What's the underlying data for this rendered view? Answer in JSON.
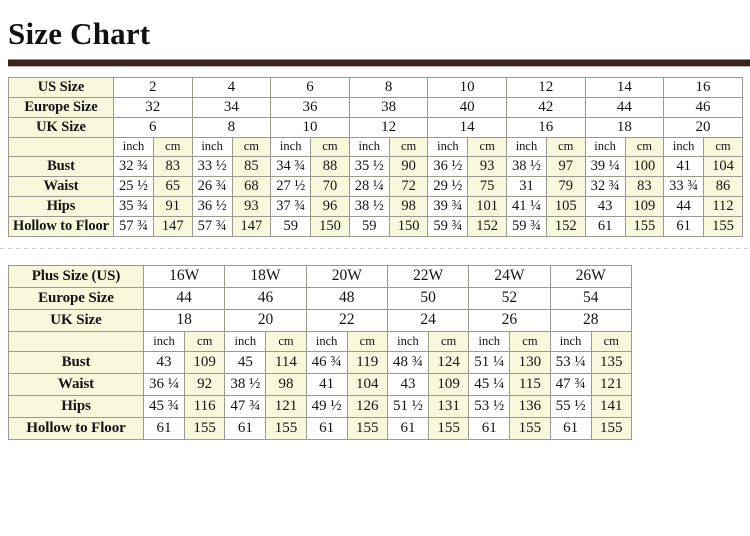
{
  "page": {
    "title": "Size Chart"
  },
  "standard_table": {
    "row_labels": {
      "us": "US Size",
      "europe": "Europe Size",
      "uk": "UK Size",
      "bust": "Bust",
      "waist": "Waist",
      "hips": "Hips",
      "hollow": "Hollow to Floor"
    },
    "units": {
      "inch": "inch",
      "cm": "cm"
    },
    "us_sizes": [
      "2",
      "4",
      "6",
      "8",
      "10",
      "12",
      "14",
      "16"
    ],
    "europe_sizes": [
      "32",
      "34",
      "36",
      "38",
      "40",
      "42",
      "44",
      "46"
    ],
    "uk_sizes": [
      "6",
      "8",
      "10",
      "12",
      "14",
      "16",
      "18",
      "20"
    ],
    "bust_inch": [
      "32 ¾",
      "33 ½",
      "34 ¾",
      "35 ½",
      "36 ½",
      "38 ½",
      "39 ¼",
      "41"
    ],
    "bust_cm": [
      "83",
      "85",
      "88",
      "90",
      "93",
      "97",
      "100",
      "104"
    ],
    "waist_inch": [
      "25 ½",
      "26 ¾",
      "27 ½",
      "28 ¼",
      "29 ½",
      "31",
      "32 ¾",
      "33 ¾"
    ],
    "waist_cm": [
      "65",
      "68",
      "70",
      "72",
      "75",
      "79",
      "83",
      "86"
    ],
    "hips_inch": [
      "35 ¾",
      "36 ½",
      "37 ¾",
      "38 ½",
      "39 ¾",
      "41 ¼",
      "43",
      "44"
    ],
    "hips_cm": [
      "91",
      "93",
      "96",
      "98",
      "101",
      "105",
      "109",
      "112"
    ],
    "hollow_inch": [
      "57 ¾",
      "57 ¾",
      "59",
      "59",
      "59 ¾",
      "59 ¾",
      "61",
      "61"
    ],
    "hollow_cm": [
      "147",
      "147",
      "150",
      "150",
      "152",
      "152",
      "155",
      "155"
    ]
  },
  "plus_table": {
    "row_labels": {
      "plus": "Plus Size (US)",
      "europe": "Europe Size",
      "uk": "UK Size",
      "bust": "Bust",
      "waist": "Waist",
      "hips": "Hips",
      "hollow": "Hollow to Floor"
    },
    "units": {
      "inch": "inch",
      "cm": "cm"
    },
    "plus_sizes": [
      "16W",
      "18W",
      "20W",
      "22W",
      "24W",
      "26W"
    ],
    "europe_sizes": [
      "44",
      "46",
      "48",
      "50",
      "52",
      "54"
    ],
    "uk_sizes": [
      "18",
      "20",
      "22",
      "24",
      "26",
      "28"
    ],
    "bust_inch": [
      "43",
      "45",
      "46 ¾",
      "48 ¾",
      "51 ¼",
      "53 ¼"
    ],
    "bust_cm": [
      "109",
      "114",
      "119",
      "124",
      "130",
      "135"
    ],
    "waist_inch": [
      "36 ¼",
      "38 ½",
      "41",
      "43",
      "45 ¼",
      "47 ¾"
    ],
    "waist_cm": [
      "92",
      "98",
      "104",
      "109",
      "115",
      "121"
    ],
    "hips_inch": [
      "45 ¾",
      "47 ¾",
      "49 ½",
      "51 ½",
      "53 ½",
      "55 ½"
    ],
    "hips_cm": [
      "116",
      "121",
      "126",
      "131",
      "136",
      "141"
    ],
    "hollow_inch": [
      "61",
      "61",
      "61",
      "61",
      "61",
      "61"
    ],
    "hollow_cm": [
      "155",
      "155",
      "155",
      "155",
      "155",
      "155"
    ]
  },
  "colors": {
    "rule": "#3a241b",
    "cell_shade": "#f8f8dc",
    "cell_plain": "#ffffff",
    "border": "#9a9a91",
    "text": "#141414"
  }
}
